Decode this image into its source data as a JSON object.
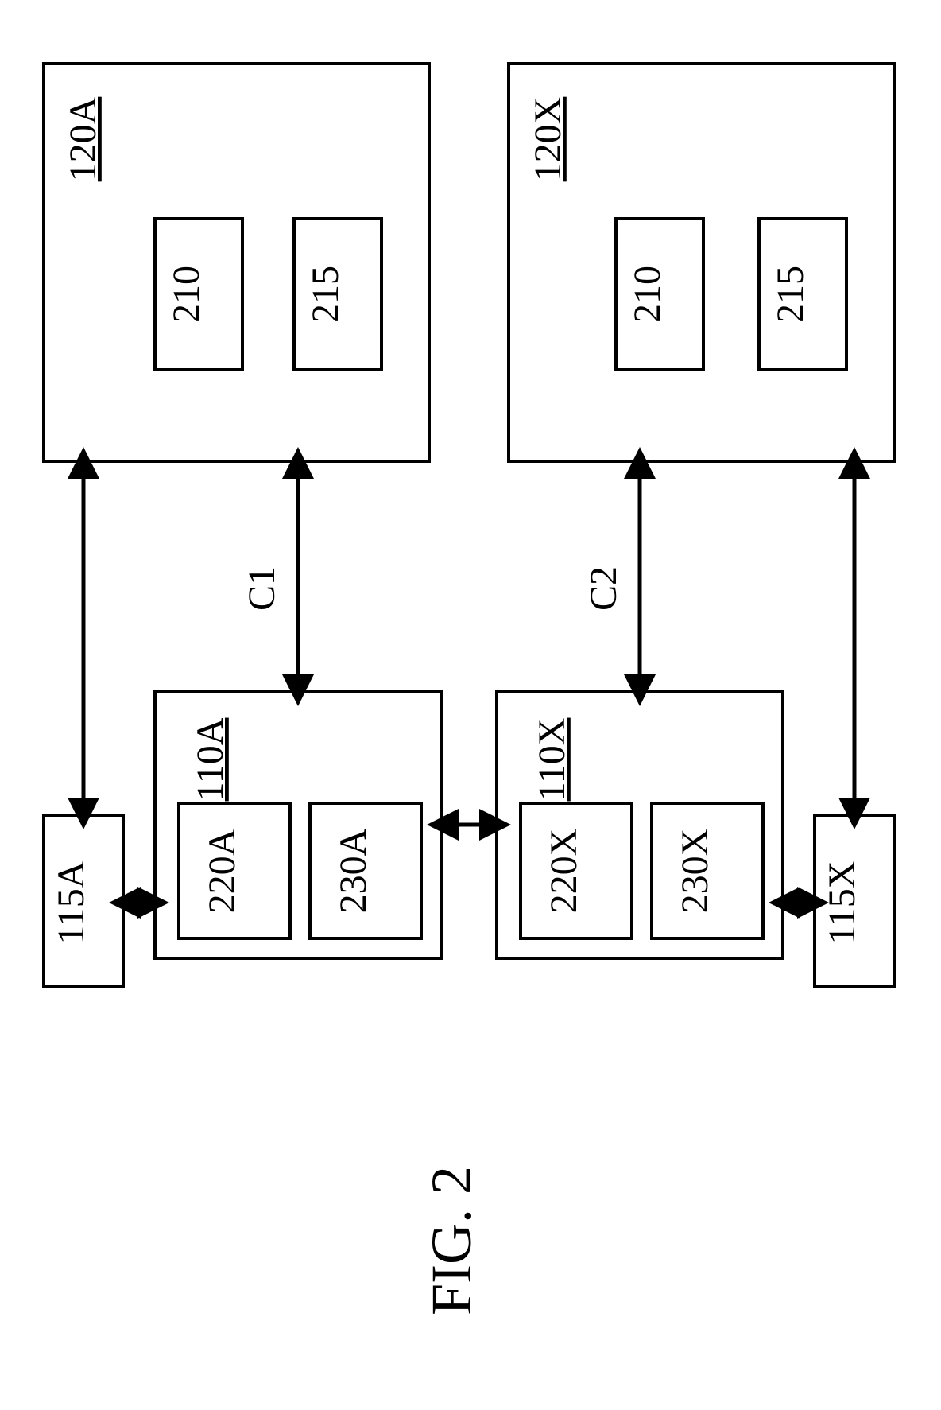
{
  "figure_label": "FIG. 2",
  "connection_labels": {
    "c1": "C1",
    "c2": "C2"
  },
  "left": {
    "upper": {
      "id": "120A",
      "child1": "210",
      "child2": "215"
    },
    "lower": {
      "id": "110A",
      "child1": "220A",
      "child2": "230A"
    },
    "side": {
      "id": "115A"
    }
  },
  "right": {
    "upper": {
      "id": "120X",
      "child1": "210",
      "child2": "215"
    },
    "lower": {
      "id": "110X",
      "child1": "220X",
      "child2": "230X"
    },
    "side": {
      "id": "115X"
    }
  }
}
